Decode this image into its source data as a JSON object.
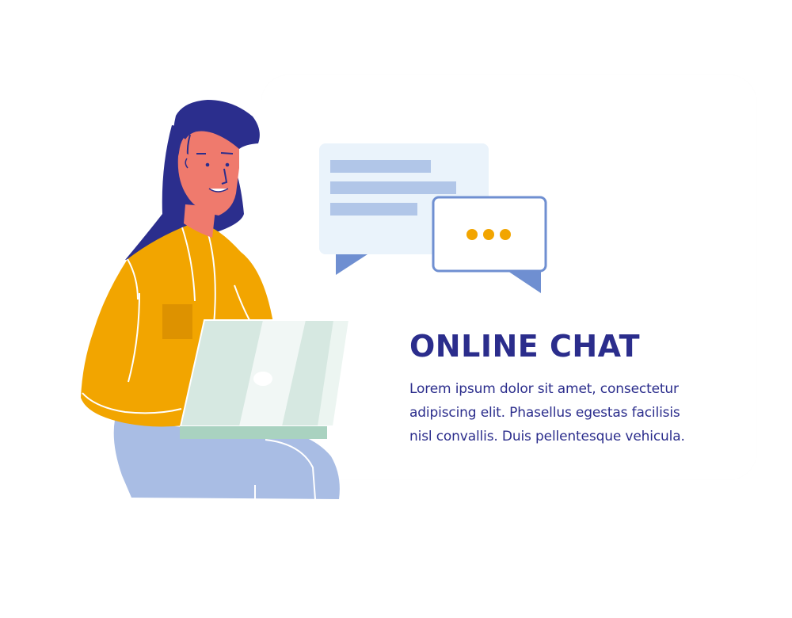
{
  "heading": "ONLINE CHAT",
  "body": "Lorem ipsum dolor sit amet, consectetur\nadipiscing elit. Phasellus egestas facilisis\nnisl convallis. Duis pellentesque vehicula.",
  "colors": {
    "text": "#2b2d8c",
    "hair": "#2b2e8d",
    "skin": "#ef7a6d",
    "shirt": "#f2a500",
    "pants": "#a9bde4",
    "laptop": "#d6e8e1",
    "bubble_light": "#eaf3fb",
    "bubble_line": "#b1c6e8",
    "bubble_outline": "#6f8fd1",
    "typing_dots": "#f2a500"
  },
  "icons": {
    "message_bubble": "message-bubble-icon",
    "typing_bubble": "typing-bubble-icon"
  }
}
